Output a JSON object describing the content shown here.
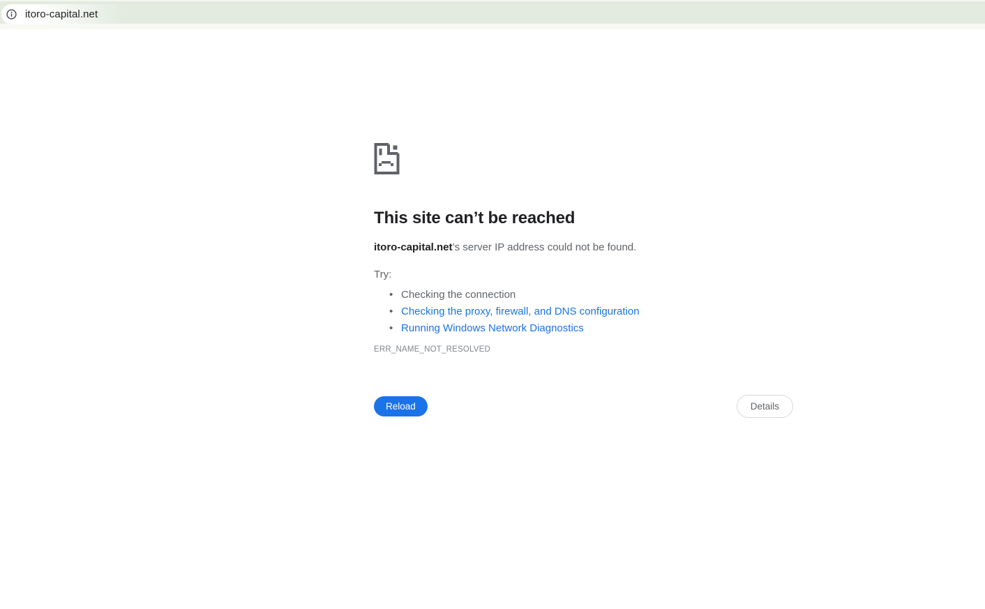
{
  "browser": {
    "address_bar": {
      "url": "itoro-capital.net",
      "icon": "info-icon"
    }
  },
  "error_page": {
    "icon": "sad-file-icon",
    "title": "This site can’t be reached",
    "host": "itoro-capital.net",
    "message_suffix": "’s server IP address could not be found.",
    "try_label": "Try:",
    "suggestions": [
      {
        "label": "Checking the connection",
        "is_link": false
      },
      {
        "label": "Checking the proxy, firewall, and DNS configuration",
        "is_link": true
      },
      {
        "label": "Running Windows Network Diagnostics",
        "is_link": true
      }
    ],
    "error_code": "ERR_NAME_NOT_RESOLVED",
    "reload_label": "Reload",
    "details_label": "Details"
  },
  "colors": {
    "toolbar_bg": "#e3ebdf",
    "toolbar_strip": "#f8f9f2",
    "link_blue": "#1a73e8",
    "primary_button_bg": "#1a73e8",
    "title_text": "#202124",
    "body_text": "#5f6368",
    "error_code_text": "#80868b",
    "details_border": "#d5d8dc"
  }
}
